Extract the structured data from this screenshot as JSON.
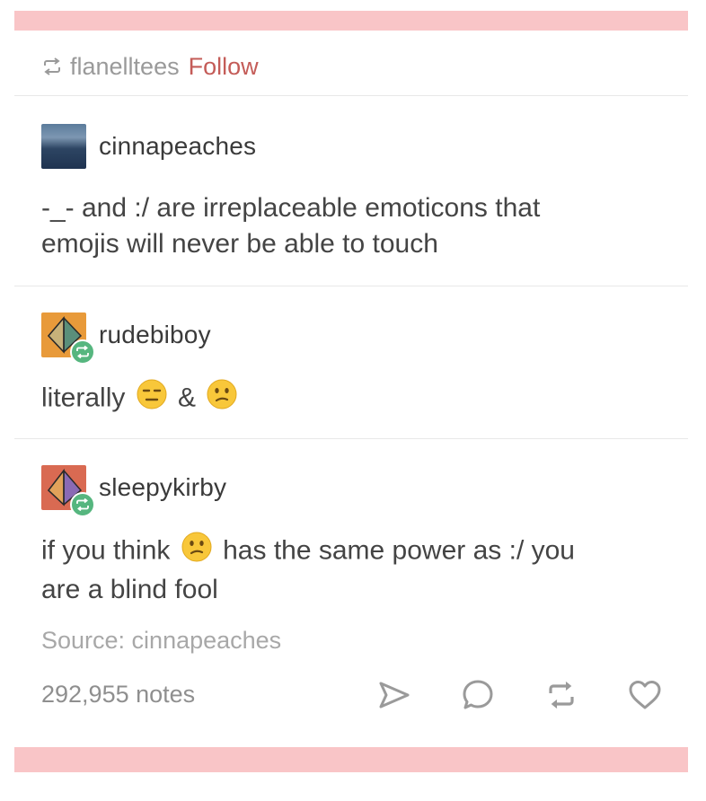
{
  "header": {
    "reblogger": "flanelltees",
    "follow_label": "Follow"
  },
  "entries": [
    {
      "username": "cinnapeaches",
      "lines": [
        "-_- and :/ are irreplaceable emoticons that",
        "emojis will never be able to touch"
      ]
    },
    {
      "username": "rudebiboy",
      "text_before": "literally",
      "text_between": "&"
    },
    {
      "username": "sleepykirby",
      "text_before": "if you think",
      "text_after": "has the same power as :/ you",
      "line2": "are a blind fool"
    }
  ],
  "footer": {
    "source": "Source: cinnapeaches",
    "notes": "292,955 notes"
  },
  "icons": {
    "reblog": "reblog-icon",
    "share": "share-icon",
    "comment": "comment-icon",
    "like": "heart-icon",
    "emoji_1": "expressionless-face-emoji",
    "emoji_2": "confused-face-emoji"
  },
  "colors": {
    "pink_bar": "#f9c5c7",
    "follow": "#c45c58",
    "reblog_badge": "#56b67f",
    "text": "#444444",
    "muted": "#a8a8a8"
  }
}
